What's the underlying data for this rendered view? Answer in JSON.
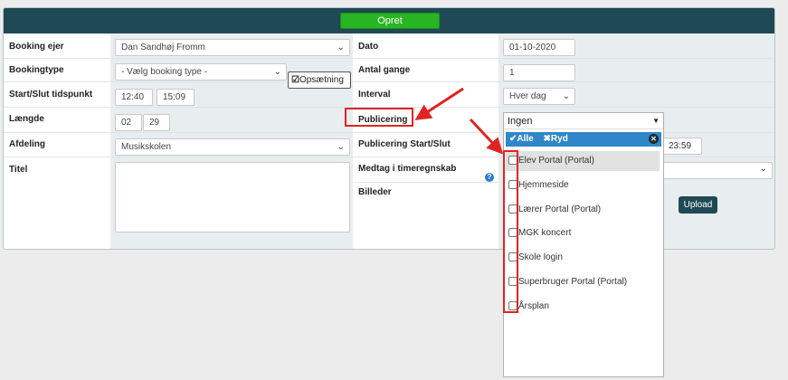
{
  "toolbar": {
    "opret": "Opret"
  },
  "form": {
    "booking_owner": {
      "label": "Booking ejer",
      "value": "Dan Sandhøj Fromm"
    },
    "booking_type": {
      "label": "Bookingtype",
      "value": "- Vælg booking type -",
      "setup_button": "Opsætning"
    },
    "start_end": {
      "label": "Start/Slut tidspunkt",
      "start": "12:40",
      "end": "15:09"
    },
    "length": {
      "label": "Længde",
      "hours": "02",
      "minutes": "29"
    },
    "department": {
      "label": "Afdeling",
      "value": "Musikskolen"
    },
    "title": {
      "label": "Titel"
    },
    "date": {
      "label": "Dato",
      "value": "01-10-2020"
    },
    "count": {
      "label": "Antal gange",
      "value": "1"
    },
    "interval": {
      "label": "Interval",
      "value": "Hver dag"
    },
    "publishing": {
      "label": "Publicering",
      "value": "Ingen"
    },
    "publishing_start_end": {
      "label": "Publicering Start/Slut",
      "end_time": "23:59"
    },
    "include_accounting": {
      "label": "Medtag i timeregnskab"
    },
    "images": {
      "label": "Billeder",
      "upload": "Upload"
    }
  },
  "dropdown": {
    "all": "Alle",
    "clear": "Ryd",
    "options": [
      "Elev Portal (Portal)",
      "Hjemmeside",
      "Lærer Portal (Portal)",
      "MGK koncert",
      "Skole login",
      "Superbruger Portal (Portal)",
      "Årsplan"
    ]
  },
  "colors": {
    "header": "#1f4a55",
    "create": "#28b523",
    "highlight": "#e02424",
    "select_bar": "#2f86c8"
  },
  "icons": [
    "edit-icon",
    "chevron-down-icon",
    "help-icon",
    "check-icon",
    "close-icon",
    "clear-circle-icon"
  ]
}
